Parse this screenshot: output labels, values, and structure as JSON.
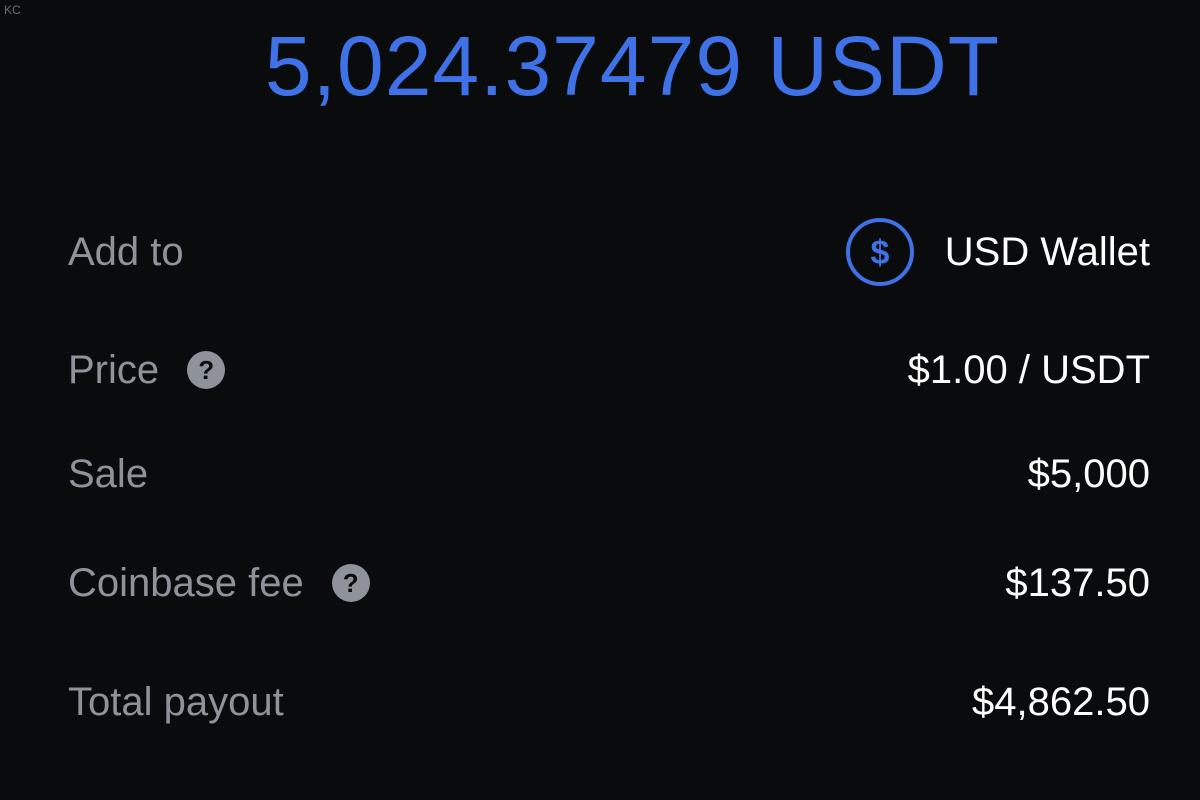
{
  "watermark": "KC",
  "amount": "5,024.37479 USDT",
  "rows": {
    "add_to": {
      "label": "Add to",
      "value": "USD Wallet",
      "icon": "dollar-circle-icon"
    },
    "price": {
      "label": "Price",
      "value": "$1.00 / USDT",
      "help": "?"
    },
    "sale": {
      "label": "Sale",
      "value": "$5,000"
    },
    "fee": {
      "label": "Coinbase fee",
      "value": "$137.50",
      "help": "?"
    },
    "total": {
      "label": "Total payout",
      "value": "$4,862.50"
    }
  },
  "colors": {
    "background": "#0a0b0d",
    "accent": "#3f72e6",
    "label": "#8d929b",
    "value": "#ffffff"
  }
}
